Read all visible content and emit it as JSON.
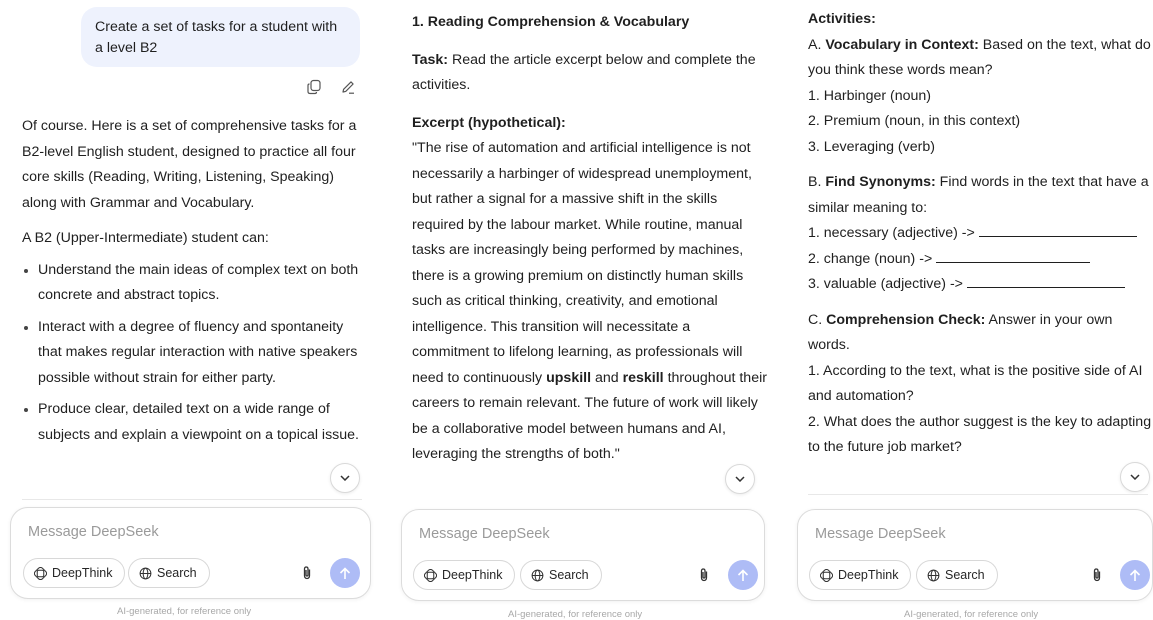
{
  "composer": {
    "placeholder": "Message DeepSeek",
    "deepthink_label": "DeepThink",
    "search_label": "Search",
    "footnote": "AI-generated, for reference only"
  },
  "panel1": {
    "user_message": "Create a set of tasks for a student with a level B2",
    "intro": "Of course. Here is a set of comprehensive tasks for a B2-level English student, designed to practice all four core skills (Reading, Writing, Listening, Speaking) along with Grammar and Vocabulary.",
    "can_heading": "A B2 (Upper-Intermediate) student can:",
    "bullets": [
      "Understand the main ideas of complex text on both concrete and abstract topics.",
      "Interact with a degree of fluency and spontaneity that makes regular interaction with native speakers possible without strain for either party.",
      "Produce clear, detailed text on a wide range of subjects and explain a viewpoint on a topical issue."
    ]
  },
  "panel2": {
    "section_title": "1. Reading Comprehension & Vocabulary",
    "task_label": "Task:",
    "task_text": " Read the article excerpt below and complete the activities.",
    "excerpt_label": "Excerpt (hypothetical):",
    "excerpt_part1": "\"The rise of automation and artificial intelligence is not necessarily a harbinger of widespread unemployment, but rather a signal for a massive shift in the skills required by the labour market. While routine, manual tasks are increasingly being performed by machines, there is a growing premium on distinctly human skills such as critical thinking, creativity, and emotional intelligence. This transition will necessitate a commitment to lifelong learning, as professionals will need to continuously ",
    "excerpt_bold1": "upskill",
    "excerpt_and": " and ",
    "excerpt_bold2": "reskill",
    "excerpt_part2": " throughout their careers to remain relevant. The future of work will likely be a collaborative model between humans and AI, leveraging the strengths of both.\""
  },
  "panel3": {
    "activities_heading": "Activities:",
    "a_prefix": "A. ",
    "a_label": "Vocabulary in Context:",
    "a_text": " Based on the text, what do you think these words mean?",
    "a_items": [
      "1. Harbinger (noun)",
      "2. Premium (noun, in this context)",
      "3. Leveraging (verb)"
    ],
    "b_prefix": "B. ",
    "b_label": "Find Synonyms:",
    "b_text": " Find words in the text that have a similar meaning to:",
    "b_items": [
      "1. necessary (adjective) -> ",
      "2. change (noun) -> ",
      "3. valuable (adjective) -> "
    ],
    "c_prefix": "C. ",
    "c_label": "Comprehension Check:",
    "c_text": " Answer in your own words.",
    "c_items": [
      "1. According to the text, what is the positive side of AI and automation?",
      "2. What does the author suggest is the key to adapting to the future job market?"
    ]
  },
  "colors": {
    "user_bubble": "#eef2fd",
    "send_button": "#aebcf6",
    "placeholder": "#9a9a9a",
    "footnote": "#a8a8a8"
  },
  "icons": [
    "copy-icon",
    "edit-icon",
    "chevron-down-icon",
    "deepthink-icon",
    "globe-icon",
    "paperclip-icon",
    "arrow-up-icon"
  ]
}
